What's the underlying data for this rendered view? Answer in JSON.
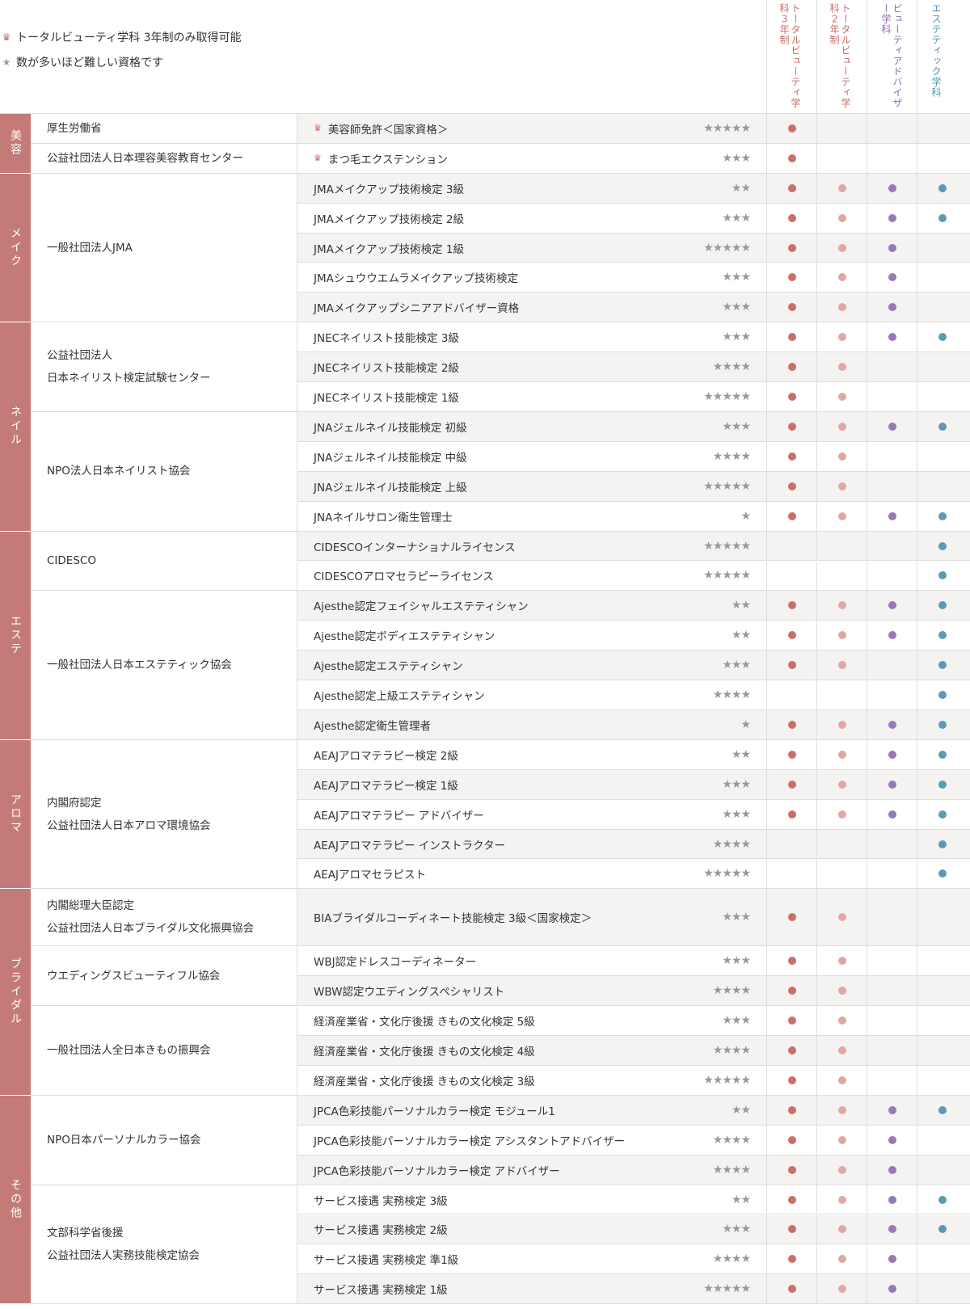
{
  "legend": {
    "crown_text": "トータルビューティ学科 3年制のみ取得可能",
    "star_text": "数が多いほど難しい資格です",
    "crown_icon": "crown-icon",
    "star_icon": "star-icon"
  },
  "columns": [
    {
      "label": "トータルビューティ学科３年制",
      "color": "#c46d68"
    },
    {
      "label": "トータルビューティ学科２年制",
      "color": "#c46d68"
    },
    {
      "label": "ビューティアドバイザー学科",
      "color": "#8e6ab0"
    },
    {
      "label": "エステティック学科",
      "color": "#4e93ac"
    }
  ],
  "dot_colors": [
    "#c9706a",
    "#dfa8a5",
    "#9679b8",
    "#5a9bb3"
  ],
  "categories": [
    {
      "label": "美容",
      "rows": 2
    },
    {
      "label": "メイク",
      "rows": 5
    },
    {
      "label": "ネイル",
      "rows": 7
    },
    {
      "label": "エステ",
      "rows": 7
    },
    {
      "label": "アロマ",
      "rows": 5
    },
    {
      "label": "ブライダル",
      "rows": 6
    },
    {
      "label": "その他",
      "rows": 7
    }
  ],
  "organizations": [
    {
      "lines": [
        "厚生労働省"
      ],
      "rows": 1
    },
    {
      "lines": [
        "公益社団法人日本理容美容教育センター"
      ],
      "rows": 1
    },
    {
      "lines": [
        "一般社団法人JMA"
      ],
      "rows": 5
    },
    {
      "lines": [
        "公益社団法人",
        "日本ネイリスト検定試験センター"
      ],
      "rows": 3
    },
    {
      "lines": [
        "NPO法人日本ネイリスト協会"
      ],
      "rows": 4
    },
    {
      "lines": [
        "CIDESCO"
      ],
      "rows": 2
    },
    {
      "lines": [
        "一般社団法人日本エステティック協会"
      ],
      "rows": 5
    },
    {
      "lines": [
        "内閣府認定",
        "公益社団法人日本アロマ環境協会"
      ],
      "rows": 5
    },
    {
      "lines": [
        "内閣総理大臣認定",
        "公益社団法人日本ブライダル文化振興協会"
      ],
      "rows": 1,
      "tall": true
    },
    {
      "lines": [
        "ウエディングスビューティフル協会"
      ],
      "rows": 2
    },
    {
      "lines": [
        "一般社団法人全日本きもの振興会"
      ],
      "rows": 3
    },
    {
      "lines": [
        "NPO日本パーソナルカラー協会"
      ],
      "rows": 3
    },
    {
      "lines": [
        "文部科学省後援",
        "公益社団法人実務技能検定協会"
      ],
      "rows": 4
    }
  ],
  "qualifications": [
    {
      "name": "美容師免許＜国家資格＞",
      "crown": true,
      "stars": "★★★★★",
      "dots": [
        1,
        0,
        0,
        0
      ]
    },
    {
      "name": "まつ毛エクステンション",
      "crown": true,
      "stars": "★★★",
      "dots": [
        1,
        0,
        0,
        0
      ]
    },
    {
      "name": "JMAメイクアップ技術検定 3級",
      "stars": "★★",
      "dots": [
        1,
        1,
        1,
        1
      ]
    },
    {
      "name": "JMAメイクアップ技術検定 2級",
      "stars": "★★★",
      "dots": [
        1,
        1,
        1,
        1
      ]
    },
    {
      "name": "JMAメイクアップ技術検定 1級",
      "stars": "★★★★★",
      "dots": [
        1,
        1,
        1,
        0
      ]
    },
    {
      "name": "JMAシュウウエムラメイクアップ技術検定",
      "stars": "★★★",
      "dots": [
        1,
        1,
        1,
        0
      ]
    },
    {
      "name": "JMAメイクアップシニアアドバイザー資格",
      "stars": "★★★",
      "dots": [
        1,
        1,
        1,
        0
      ]
    },
    {
      "name": "JNECネイリスト技能検定 3級",
      "stars": "★★★",
      "dots": [
        1,
        1,
        1,
        1
      ]
    },
    {
      "name": "JNECネイリスト技能検定 2級",
      "stars": "★★★★",
      "dots": [
        1,
        1,
        0,
        0
      ]
    },
    {
      "name": "JNECネイリスト技能検定 1級",
      "stars": "★★★★★",
      "dots": [
        1,
        1,
        0,
        0
      ]
    },
    {
      "name": "JNAジェルネイル技能検定 初級",
      "stars": "★★★",
      "dots": [
        1,
        1,
        1,
        1
      ]
    },
    {
      "name": "JNAジェルネイル技能検定 中級",
      "stars": "★★★★",
      "dots": [
        1,
        1,
        0,
        0
      ]
    },
    {
      "name": "JNAジェルネイル技能検定 上級",
      "stars": "★★★★★",
      "dots": [
        1,
        1,
        0,
        0
      ]
    },
    {
      "name": "JNAネイルサロン衛生管理士",
      "stars": "★",
      "dots": [
        1,
        1,
        1,
        1
      ]
    },
    {
      "name": "CIDESCOインターナショナルライセンス",
      "stars": "★★★★★",
      "dots": [
        0,
        0,
        0,
        1
      ]
    },
    {
      "name": "CIDESCOアロマセラピーライセンス",
      "stars": "★★★★★",
      "dots": [
        0,
        0,
        0,
        1
      ]
    },
    {
      "name": "Ajesthe認定フェイシャルエステティシャン",
      "stars": "★★",
      "dots": [
        1,
        1,
        1,
        1
      ]
    },
    {
      "name": "Ajesthe認定ボディエステティシャン",
      "stars": "★★",
      "dots": [
        1,
        1,
        1,
        1
      ]
    },
    {
      "name": "Ajesthe認定エステティシャン",
      "stars": "★★★",
      "dots": [
        1,
        1,
        0,
        1
      ]
    },
    {
      "name": "Ajesthe認定上級エステティシャン",
      "stars": "★★★★",
      "dots": [
        0,
        0,
        0,
        1
      ]
    },
    {
      "name": "Ajesthe認定衛生管理者",
      "stars": "★",
      "dots": [
        1,
        1,
        1,
        1
      ]
    },
    {
      "name": "AEAJアロマテラピー検定 2級",
      "stars": "★★",
      "dots": [
        1,
        1,
        1,
        1
      ]
    },
    {
      "name": "AEAJアロマテラピー検定 1級",
      "stars": "★★★",
      "dots": [
        1,
        1,
        1,
        1
      ]
    },
    {
      "name": "AEAJアロマテラピー アドバイザー",
      "stars": "★★★",
      "dots": [
        1,
        1,
        1,
        1
      ]
    },
    {
      "name": "AEAJアロマテラピー インストラクター",
      "stars": "★★★★",
      "dots": [
        0,
        0,
        0,
        1
      ]
    },
    {
      "name": "AEAJアロマセラピスト",
      "stars": "★★★★★",
      "dots": [
        0,
        0,
        0,
        1
      ]
    },
    {
      "name": "BIAブライダルコーディネート技能検定 3級＜国家検定＞",
      "stars": "★★★",
      "dots": [
        1,
        1,
        0,
        0
      ],
      "tall": true
    },
    {
      "name": "WBJ認定ドレスコーディネーター",
      "stars": "★★★",
      "dots": [
        1,
        1,
        0,
        0
      ]
    },
    {
      "name": "WBW認定ウエディングスペシャリスト",
      "stars": "★★★★",
      "dots": [
        1,
        1,
        0,
        0
      ]
    },
    {
      "name": "経済産業省・文化庁後援 きもの文化検定 5級",
      "stars": "★★★",
      "dots": [
        1,
        1,
        0,
        0
      ]
    },
    {
      "name": "経済産業省・文化庁後援 きもの文化検定 4級",
      "stars": "★★★★",
      "dots": [
        1,
        1,
        0,
        0
      ]
    },
    {
      "name": "経済産業省・文化庁後援 きもの文化検定 3級",
      "stars": "★★★★★",
      "dots": [
        1,
        1,
        0,
        0
      ]
    },
    {
      "name": "JPCA色彩技能パーソナルカラー検定 モジュール1",
      "stars": "★★",
      "dots": [
        1,
        1,
        1,
        1
      ]
    },
    {
      "name": "JPCA色彩技能パーソナルカラー検定 アシスタントアドバイザー",
      "stars": "★★★★",
      "dots": [
        1,
        1,
        1,
        0
      ]
    },
    {
      "name": "JPCA色彩技能パーソナルカラー検定 アドバイザー",
      "stars": "★★★★",
      "dots": [
        1,
        1,
        1,
        0
      ]
    },
    {
      "name": "サービス接遇 実務検定 3級",
      "stars": "★★",
      "dots": [
        1,
        1,
        1,
        1
      ]
    },
    {
      "name": "サービス接遇 実務検定 2級",
      "stars": "★★★",
      "dots": [
        1,
        1,
        1,
        1
      ]
    },
    {
      "name": "サービス接遇 実務検定 準1級",
      "stars": "★★★★",
      "dots": [
        1,
        1,
        1,
        0
      ]
    },
    {
      "name": "サービス接遇 実務検定 1級",
      "stars": "★★★★★",
      "dots": [
        1,
        1,
        1,
        0
      ]
    }
  ]
}
